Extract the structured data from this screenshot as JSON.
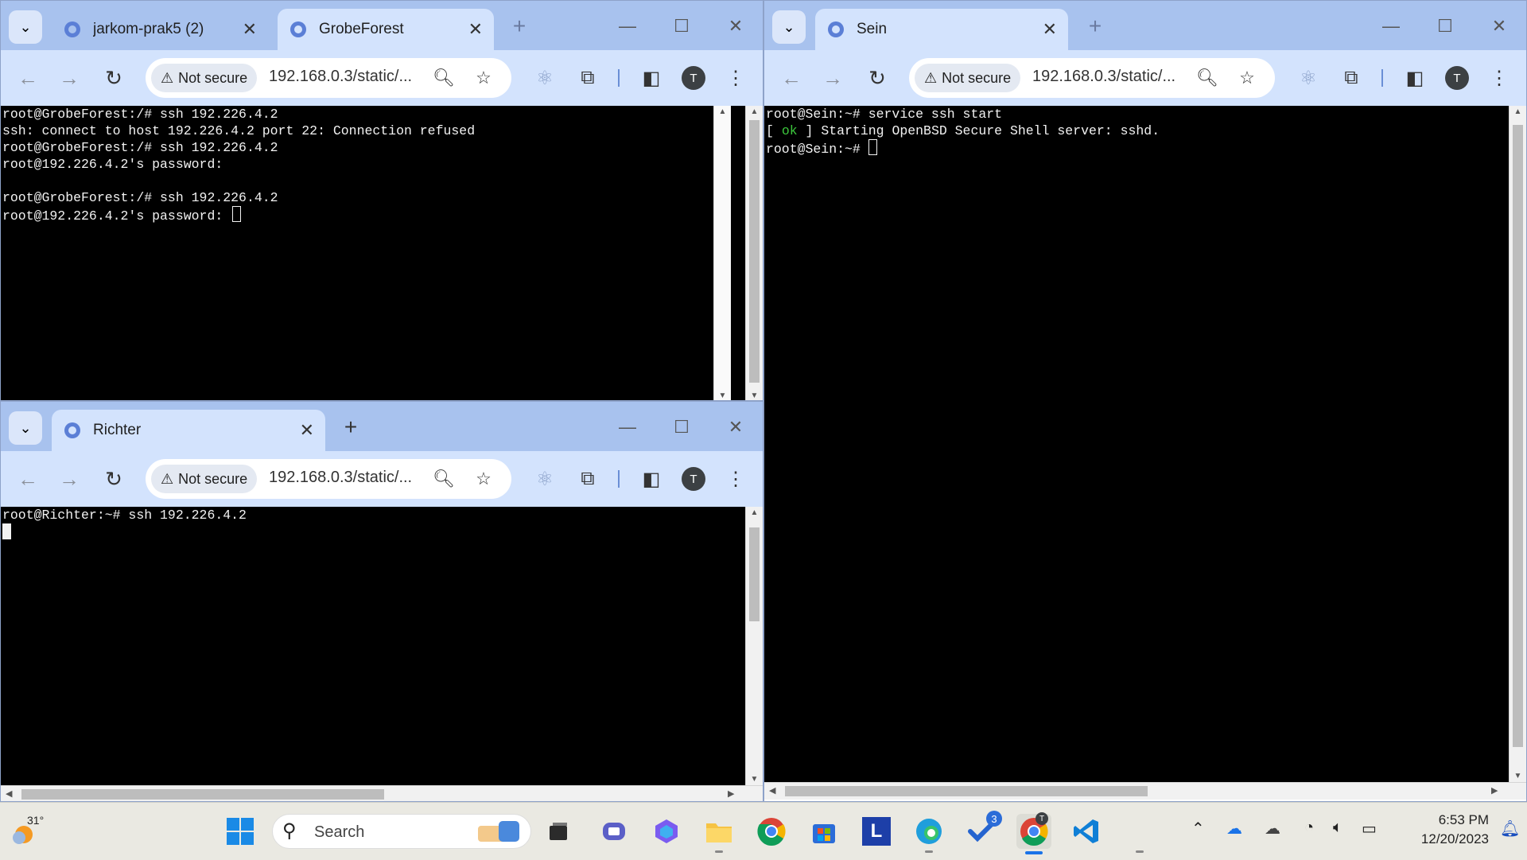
{
  "top_left_window": {
    "tabs": [
      {
        "label": "jarkom-prak5 (2)",
        "active": false
      },
      {
        "label": "GrobeForest",
        "active": true
      }
    ],
    "security_chip": "Not secure",
    "url": "192.168.0.3/static/...",
    "avatar_letter": "T",
    "terminal_lines": [
      "root@GrobeForest:/# ssh 192.226.4.2",
      "ssh: connect to host 192.226.4.2 port 22: Connection refused",
      "root@GrobeForest:/# ssh 192.226.4.2",
      "root@192.226.4.2's password:",
      "",
      "root@GrobeForest:/# ssh 192.226.4.2",
      "root@192.226.4.2's password: "
    ]
  },
  "bottom_left_window": {
    "tabs": [
      {
        "label": "Richter",
        "active": true
      }
    ],
    "security_chip": "Not secure",
    "url": "192.168.0.3/static/...",
    "avatar_letter": "T",
    "terminal_lines": [
      "root@Richter:~# ssh 192.226.4.2"
    ]
  },
  "right_window": {
    "tabs": [
      {
        "label": "Sein",
        "active": true
      }
    ],
    "security_chip": "Not secure",
    "url": "192.168.0.3/static/...",
    "avatar_letter": "T",
    "terminal": {
      "line1": "root@Sein:~# service ssh start",
      "line2_open": "[ ",
      "line2_ok": "ok",
      "line2_rest": " ] Starting OpenBSD Secure Shell server: sshd.",
      "line3": "root@Sein:~# "
    }
  },
  "taskbar": {
    "weather_temp": "31°",
    "search_placeholder": "Search",
    "todo_badge": "3",
    "chrome_profile_badge": "T",
    "l_app_letter": "L",
    "time": "6:53 PM",
    "date": "12/20/2023"
  },
  "colors": {
    "tabstrip": "#a8c2ee",
    "toolbar": "#d3e3fd",
    "terminal_bg": "#000000",
    "taskbar": "#eae9e2"
  }
}
